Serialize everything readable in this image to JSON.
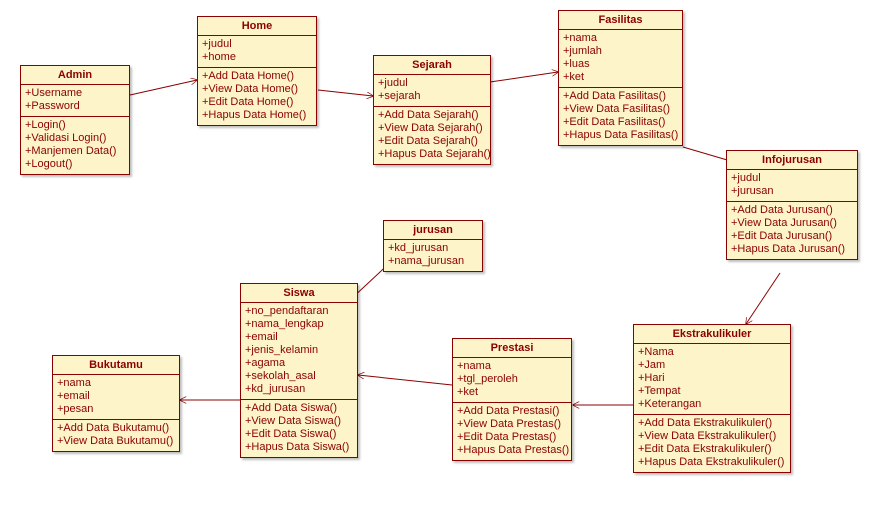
{
  "classes": {
    "admin": {
      "title": "Admin",
      "attrs": [
        "+Username",
        "+Password"
      ],
      "ops": [
        "+Login()",
        "+Validasi Login()",
        "+Manjemen Data()",
        "+Logout()"
      ]
    },
    "home": {
      "title": "Home",
      "attrs": [
        "+judul",
        "+home"
      ],
      "ops": [
        "+Add Data Home()",
        "+View Data Home()",
        "+Edit Data Home()",
        "+Hapus Data Home()"
      ]
    },
    "sejarah": {
      "title": "Sejarah",
      "attrs": [
        "+judul",
        "+sejarah"
      ],
      "ops": [
        "+Add Data Sejarah()",
        "+View Data Sejarah()",
        "+Edit Data Sejarah()",
        "+Hapus Data Sejarah()"
      ]
    },
    "fasilitas": {
      "title": "Fasilitas",
      "attrs": [
        "+nama",
        "+jumlah",
        "+luas",
        "+ket"
      ],
      "ops": [
        "+Add Data Fasilitas()",
        "+View  Data Fasilitas()",
        "+Edit  Data Fasilitas()",
        "+Hapus  Data Fasilitas()"
      ]
    },
    "infojurusan": {
      "title": "Infojurusan",
      "attrs": [
        "+judul",
        "+jurusan"
      ],
      "ops": [
        "+Add Data Jurusan()",
        "+View Data Jurusan()",
        "+Edit  Data Jurusan()",
        "+Hapus  Data Jurusan()"
      ]
    },
    "jurusan": {
      "title": "jurusan",
      "attrs": [
        "+kd_jurusan",
        "+nama_jurusan"
      ],
      "ops": []
    },
    "siswa": {
      "title": "Siswa",
      "attrs": [
        "+no_pendaftaran",
        "+nama_lengkap",
        "+email",
        "+jenis_kelamin",
        "+agama",
        "+sekolah_asal",
        "+kd_jurusan"
      ],
      "ops": [
        "+Add Data Siswa()",
        "+View Data Siswa()",
        "+Edit Data Siswa()",
        "+Hapus Data Siswa()"
      ]
    },
    "prestasi": {
      "title": "Prestasi",
      "attrs": [
        "+nama",
        "+tgl_peroleh",
        "+ket"
      ],
      "ops": [
        "+Add Data Prestasi()",
        "+View Data Prestas()",
        "+Edit Data Prestas()",
        "+Hapus Data Prestas()"
      ]
    },
    "ekstrakulikuler": {
      "title": "Ekstrakulikuler",
      "attrs": [
        "+Nama",
        "+Jam",
        "+Hari",
        "+Tempat",
        "+Keterangan"
      ],
      "ops": [
        "+Add Data Ekstrakulikuler()",
        "+View Data Ekstrakulikuler()",
        "+Edit Data Ekstrakulikuler()",
        "+Hapus Data Ekstrakulikuler()"
      ]
    },
    "bukutamu": {
      "title": "Bukutamu",
      "attrs": [
        "+nama",
        "+email",
        "+pesan"
      ],
      "ops": [
        "+Add Data Bukutamu()",
        "+View Data Bukutamu()"
      ]
    }
  }
}
